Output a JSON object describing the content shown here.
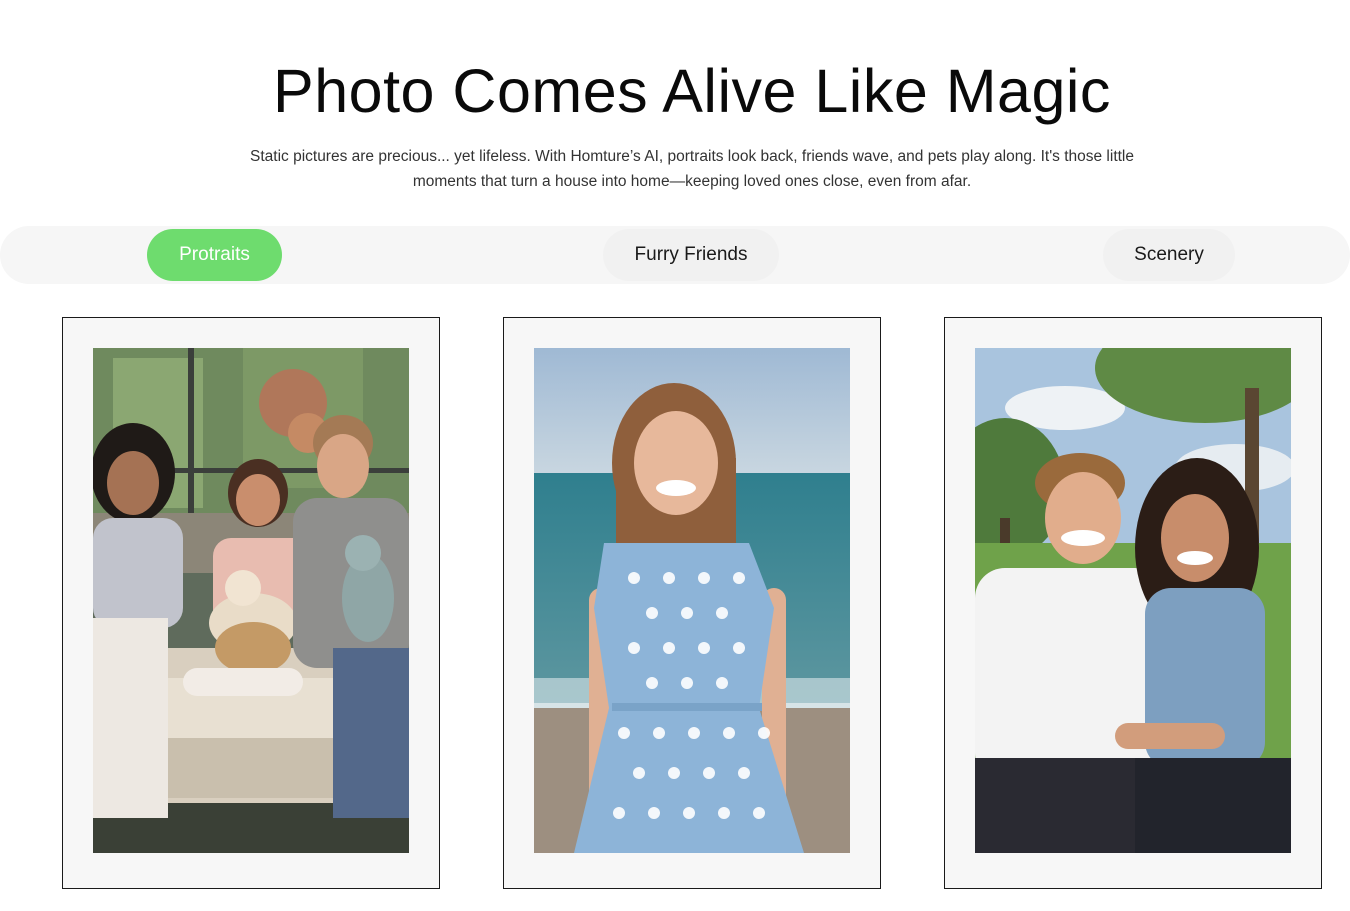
{
  "header": {
    "title": "Photo Comes Alive Like Magic",
    "subtitle": "Static pictures are precious... yet lifeless. With Homture’s AI, portraits look back, friends wave, and pets play along. It's those little moments that turn a house into home—keeping loved ones close, even from afar."
  },
  "tabs": [
    {
      "label": "Protraits",
      "active": true
    },
    {
      "label": "Furry Friends",
      "active": false
    },
    {
      "label": "Scenery",
      "active": false
    }
  ],
  "colors": {
    "accent": "#6edc6e",
    "tab_bar": "#f6f6f6",
    "frame_border": "#1a1a1a"
  },
  "photos": [
    {
      "scene": "family-on-sofa-photo"
    },
    {
      "scene": "girl-on-beach-photo"
    },
    {
      "scene": "couple-in-park-photo"
    }
  ]
}
